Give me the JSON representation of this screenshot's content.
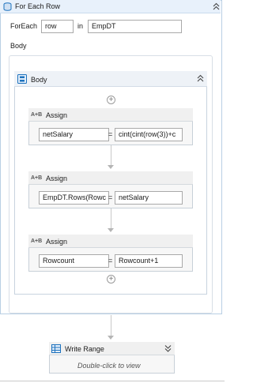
{
  "foreach": {
    "title": "For Each Row",
    "foreach_label": "ForEach",
    "row_value": "row",
    "in_label": "in",
    "table_value": "EmpDT",
    "body_label": "Body"
  },
  "sequence": {
    "title": "Body"
  },
  "assigns": [
    {
      "title": "Assign",
      "to": "netSalary",
      "value": "cint(cint(row(3))+c"
    },
    {
      "title": "Assign",
      "to": "EmpDT.Rows(Rowc",
      "value": "netSalary"
    },
    {
      "title": "Assign",
      "to": "Rowcount",
      "value": "Rowcount+1"
    }
  ],
  "write_range": {
    "title": "Write Range",
    "hint": "Double-click to view"
  },
  "icons": {
    "assign_badge": "A+B",
    "collapse": "collapse-chevrons-icon",
    "expand": "expand-chevrons-icon",
    "add": "plus-circle-icon",
    "foreach": "database-icon",
    "sequence": "sequence-icon",
    "excel": "table-icon"
  },
  "colors": {
    "header_bg": "#e8f1fb",
    "border": "#b9cfe4",
    "accent": "#1e73be"
  }
}
